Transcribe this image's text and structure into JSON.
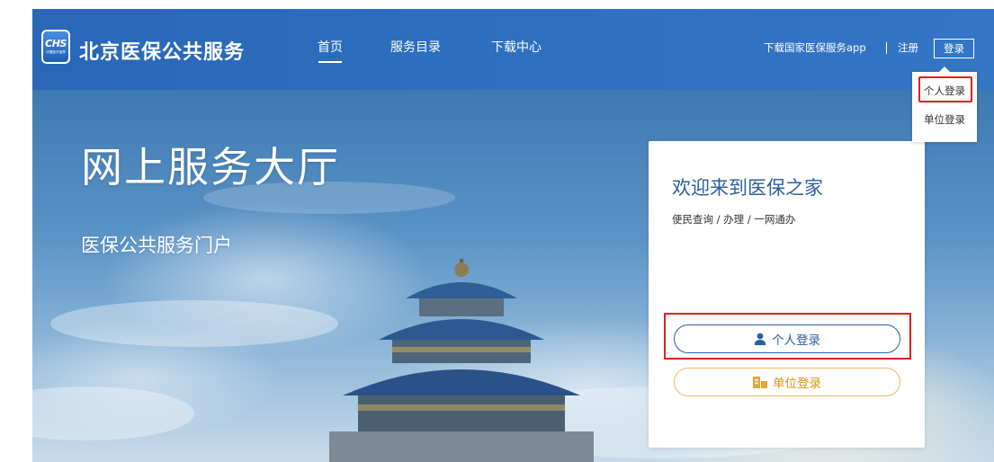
{
  "header": {
    "logo_text": "CHS",
    "logo_subtext": "中国医疗保障",
    "site_title": "北京医保公共服务",
    "nav": [
      {
        "label": "首页"
      },
      {
        "label": "服务目录"
      },
      {
        "label": "下载中心"
      }
    ],
    "download_app": "下载国家医保服务app",
    "register": "注册",
    "login": "登录"
  },
  "dropdown": {
    "items": [
      {
        "label": "个人登录"
      },
      {
        "label": "单位登录"
      }
    ]
  },
  "hero": {
    "title": "网上服务大厅",
    "subtitle": "医保公共服务门户"
  },
  "card": {
    "title": "欢迎来到医保之家",
    "subtitle": "便民查询 / 办理 / 一网通办",
    "personal_login": "个人登录",
    "unit_login": "单位登录"
  },
  "colors": {
    "header_blue": "#2e70c0",
    "card_blue": "#2d5f9e",
    "accent_orange": "#f1b85a",
    "highlight_red": "#e02020"
  },
  "icons": {
    "personal": "person-icon",
    "unit": "building-icon"
  }
}
